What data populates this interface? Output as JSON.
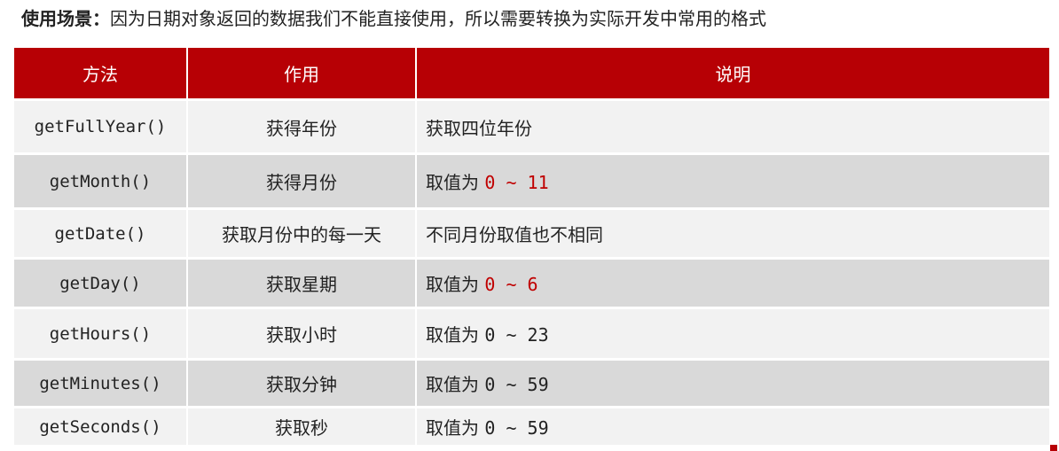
{
  "heading": {
    "label": "使用场景：",
    "text": "因为日期对象返回的数据我们不能直接使用，所以需要转换为实际开发中常用的格式"
  },
  "table": {
    "columns": [
      "方法",
      "作用",
      "说明"
    ],
    "rows": [
      {
        "method": "getFullYear()",
        "use": "获得年份",
        "desc": "获取四位年份",
        "range": "",
        "highlight": false
      },
      {
        "method": "getMonth()",
        "use": "获得月份",
        "desc": "取值为 ",
        "range": "0 ~ 11",
        "highlight": true
      },
      {
        "method": "getDate()",
        "use": "获取月份中的每一天",
        "desc": "不同月份取值也不相同",
        "range": "",
        "highlight": false
      },
      {
        "method": "getDay()",
        "use": "获取星期",
        "desc": "取值为 ",
        "range": "0 ~ 6",
        "highlight": true
      },
      {
        "method": "getHours()",
        "use": "获取小时",
        "desc": "取值为 ",
        "range": "0 ~ 23",
        "highlight": false
      },
      {
        "method": "getMinutes()",
        "use": "获取分钟",
        "desc": "取值为 ",
        "range": "0 ~ 59",
        "highlight": false
      },
      {
        "method": "getSeconds()",
        "use": "获取秒",
        "desc": "取值为 ",
        "range": "0 ~ 59",
        "highlight": false
      }
    ]
  },
  "colors": {
    "header_bg": "#b70005",
    "row_light": "#f2f2f2",
    "row_dark": "#d9d9d9",
    "highlight_text": "#c00000"
  }
}
